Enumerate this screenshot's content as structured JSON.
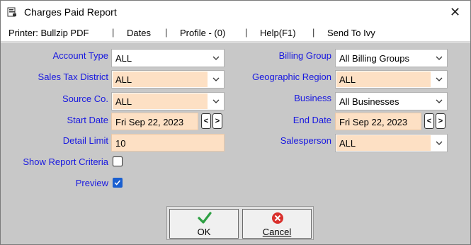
{
  "window": {
    "title": "Charges Paid Report",
    "close_glyph": "✕"
  },
  "menu": {
    "items": [
      "Printer: Bullzip PDF",
      "Dates",
      "Profile - (0)",
      "Help(F1)",
      "Send To Ivy"
    ],
    "separator": "|"
  },
  "fields": {
    "account_type": {
      "label": "Account Type",
      "value": "ALL"
    },
    "sales_tax_district": {
      "label": "Sales Tax District",
      "value": "ALL"
    },
    "source_co": {
      "label": "Source Co.",
      "value": "ALL"
    },
    "start_date": {
      "label": "Start Date",
      "value": "Fri Sep 22, 2023"
    },
    "detail_limit": {
      "label": "Detail Limit",
      "value": "10"
    },
    "show_report_criteria": {
      "label": "Show Report Criteria",
      "checked": false
    },
    "preview": {
      "label": "Preview",
      "checked": true
    },
    "billing_group": {
      "label": "Billing Group",
      "value": "All Billing Groups"
    },
    "geographic_region": {
      "label": "Geographic Region",
      "value": "ALL"
    },
    "business": {
      "label": "Business",
      "value": "All Businesses"
    },
    "end_date": {
      "label": "End Date",
      "value": "Fri Sep 22, 2023"
    },
    "salesperson": {
      "label": "Salesperson",
      "value": "ALL"
    }
  },
  "spin": {
    "prev": "<",
    "next": ">"
  },
  "buttons": {
    "ok": "OK",
    "cancel": "Cancel"
  },
  "colors": {
    "label_blue": "#1818e0",
    "field_peach": "#fde0c4",
    "form_bg": "#c8c8c8",
    "check_blue": "#1a5fd0",
    "ok_green": "#2ea043",
    "cancel_red": "#d9302c"
  },
  "icons": {
    "title": "report-window-icon",
    "dropdown": "chevron-down-icon",
    "ok": "green-checkmark-icon",
    "cancel": "red-x-circle-icon"
  }
}
